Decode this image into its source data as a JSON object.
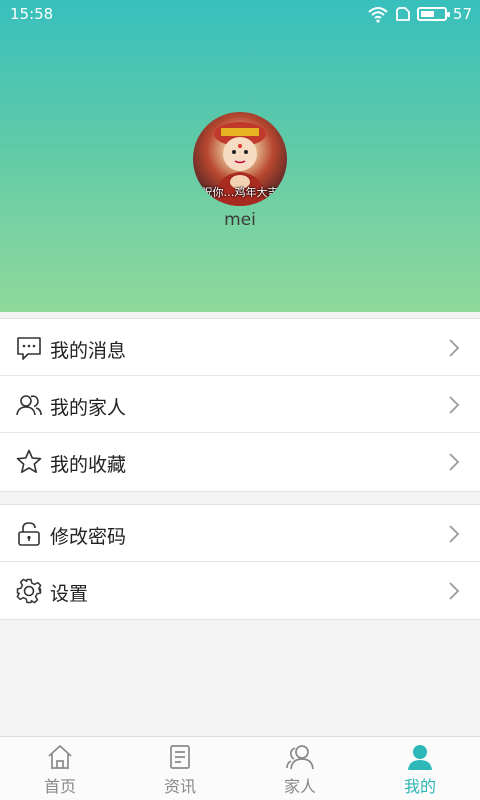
{
  "status_bar": {
    "time": "15:58",
    "battery_level": "57",
    "battery_fraction": 0.57
  },
  "profile": {
    "avatar_caption": "祝你…鸡年大吉",
    "username": "mei"
  },
  "menu_group_1": [
    {
      "label": "我的消息",
      "icon": "message-icon"
    },
    {
      "label": "我的家人",
      "icon": "people-icon"
    },
    {
      "label": "我的收藏",
      "icon": "star-icon"
    }
  ],
  "menu_group_2": [
    {
      "label": "修改密码",
      "icon": "lock-icon"
    },
    {
      "label": "设置",
      "icon": "gear-icon"
    }
  ],
  "tabbar": {
    "tabs": [
      {
        "label": "首页",
        "icon": "home-icon"
      },
      {
        "label": "资讯",
        "icon": "document-icon"
      },
      {
        "label": "家人",
        "icon": "family-icon"
      },
      {
        "label": "我的",
        "icon": "person-icon",
        "active": true
      }
    ]
  },
  "colors": {
    "accent": "#2cb8b6",
    "header_top": "#38bfbd",
    "header_bottom": "#90d99b"
  }
}
